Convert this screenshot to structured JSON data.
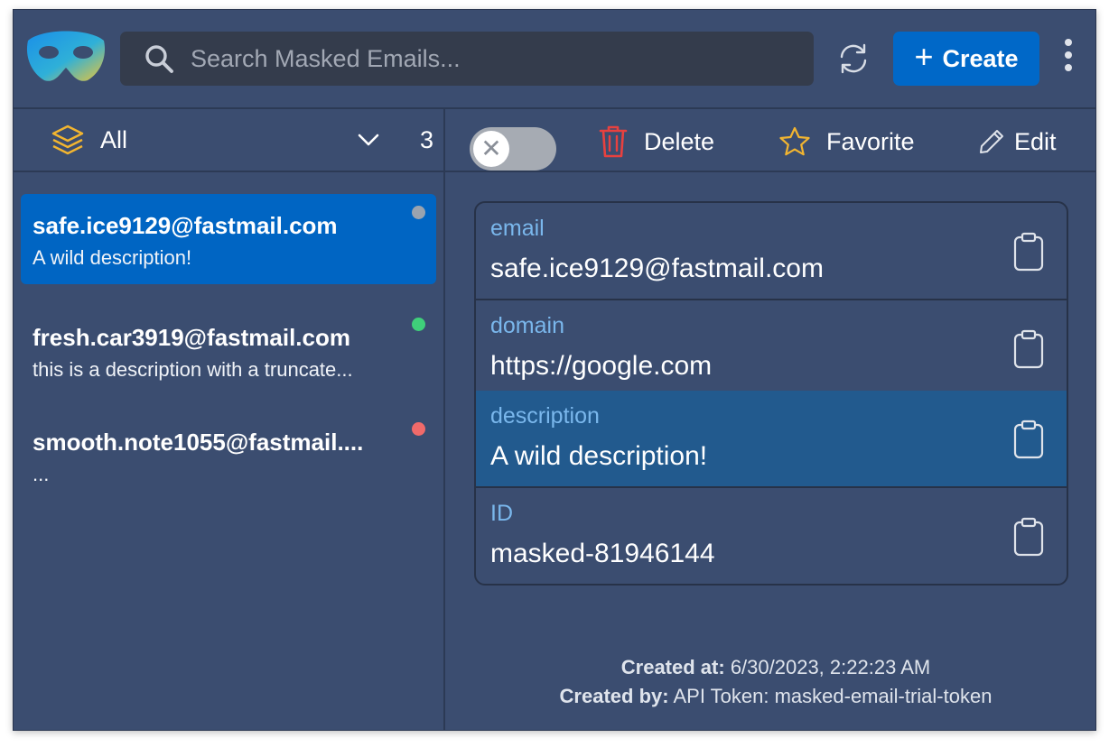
{
  "search": {
    "placeholder": "Search Masked Emails..."
  },
  "header": {
    "create_label": "Create"
  },
  "filter": {
    "label": "All",
    "count": "3"
  },
  "toolbar": {
    "delete_label": "Delete",
    "favorite_label": "Favorite",
    "edit_label": "Edit",
    "toggle_symbol": "✕"
  },
  "list": {
    "items": [
      {
        "email": "safe.ice9129@fastmail.com",
        "description": "A wild description!",
        "status_color": "#9aa3af",
        "selected": true
      },
      {
        "email": "fresh.car3919@fastmail.com",
        "description": "this is a description with a truncate...",
        "status_color": "#3fd07a",
        "selected": false
      },
      {
        "email": "smooth.note1055@fastmail....",
        "description": "...",
        "status_color": "#f06a6a",
        "selected": false
      }
    ]
  },
  "details": {
    "fields": [
      {
        "label": "email",
        "value": "safe.ice9129@fastmail.com"
      },
      {
        "label": "domain",
        "value": "https://google.com"
      },
      {
        "label": "description",
        "value": "A wild description!"
      },
      {
        "label": "ID",
        "value": "masked-81946144"
      }
    ],
    "created_at_label": "Created at:",
    "created_at_value": "6/30/2023, 2:22:23 AM",
    "created_by_label": "Created by:",
    "created_by_value": "API Token: masked-email-trial-token"
  },
  "colors": {
    "background": "#3b4d70",
    "accent": "#0068c8",
    "delete": "#e8413f",
    "favorite": "#f2b530",
    "label": "#7ab7ec"
  }
}
